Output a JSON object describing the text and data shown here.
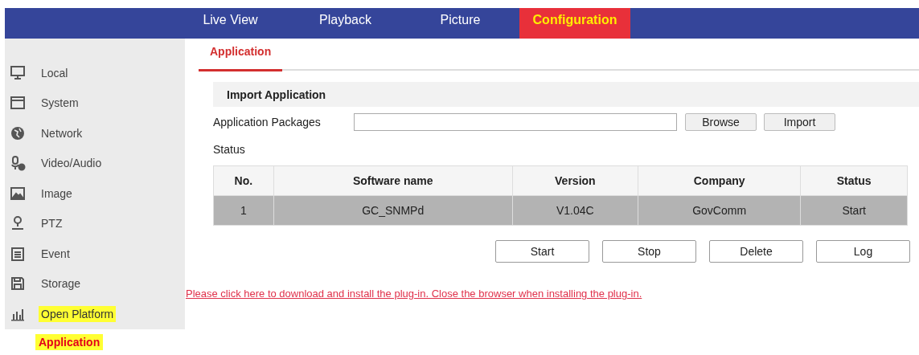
{
  "top_nav": [
    {
      "label": "Live View",
      "selected": false
    },
    {
      "label": "Playback",
      "selected": false
    },
    {
      "label": "Picture",
      "selected": false
    },
    {
      "label": "Configuration",
      "selected": true
    }
  ],
  "sidebar": {
    "items": [
      {
        "label": "Local",
        "highlighted": false
      },
      {
        "label": "System",
        "highlighted": false
      },
      {
        "label": "Network",
        "highlighted": false
      },
      {
        "label": "Video/Audio",
        "highlighted": false
      },
      {
        "label": "Image",
        "highlighted": false
      },
      {
        "label": "PTZ",
        "highlighted": false
      },
      {
        "label": "Event",
        "highlighted": false
      },
      {
        "label": "Storage",
        "highlighted": false
      },
      {
        "label": "Open Platform",
        "highlighted": true
      }
    ],
    "subitems": [
      {
        "label": "Application",
        "highlighted": true,
        "selected": true
      }
    ]
  },
  "sub_tabs": [
    {
      "label": "Application",
      "selected": true
    }
  ],
  "section": {
    "title": "Import Application",
    "packages_label": "Application Packages",
    "package_buttons": [
      "Browse",
      "Import"
    ],
    "status_label": "Status"
  },
  "table": {
    "columns": [
      "No.",
      "Software name",
      "Version",
      "Company",
      "Status"
    ],
    "rows": [
      {
        "cells": [
          "1",
          "GC_SNMPd",
          "V1.04C",
          "GovComm",
          "Start"
        ],
        "selected": true
      }
    ]
  },
  "actions": [
    "Start",
    "Stop",
    "Delete",
    "Log"
  ],
  "plugin_link": "Please click here to download and install the plug-in. Close the browser when installing the plug-in."
}
